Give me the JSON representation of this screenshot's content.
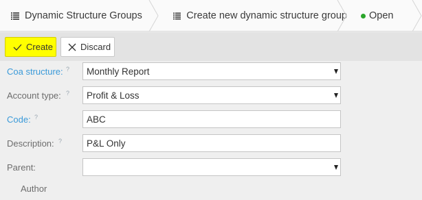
{
  "breadcrumb": {
    "items": [
      {
        "label": "Dynamic Structure Groups",
        "icon": "grid-icon"
      },
      {
        "label": "Create new dynamic structure group",
        "icon": "grid-icon"
      },
      {
        "label": "Open",
        "icon": "status-dot-icon"
      }
    ],
    "status_color": "#2aa52a"
  },
  "toolbar": {
    "create_label": "Create",
    "discard_label": "Discard",
    "create_color": "#ffff00"
  },
  "form": {
    "coa_structure": {
      "label": "Coa structure:",
      "help": "?",
      "value": "Monthly Report"
    },
    "account_type": {
      "label": "Account type:",
      "help": "?",
      "value": "Profit & Loss"
    },
    "code": {
      "label": "Code:",
      "help": "?",
      "value": "ABC"
    },
    "description": {
      "label": "Description:",
      "help": "?",
      "value": "P&L Only"
    },
    "parent": {
      "label": "Parent:",
      "value": ""
    },
    "author_label": "Author"
  },
  "colors": {
    "required_label": "#3a9ad9",
    "label": "#6d6d6d"
  }
}
